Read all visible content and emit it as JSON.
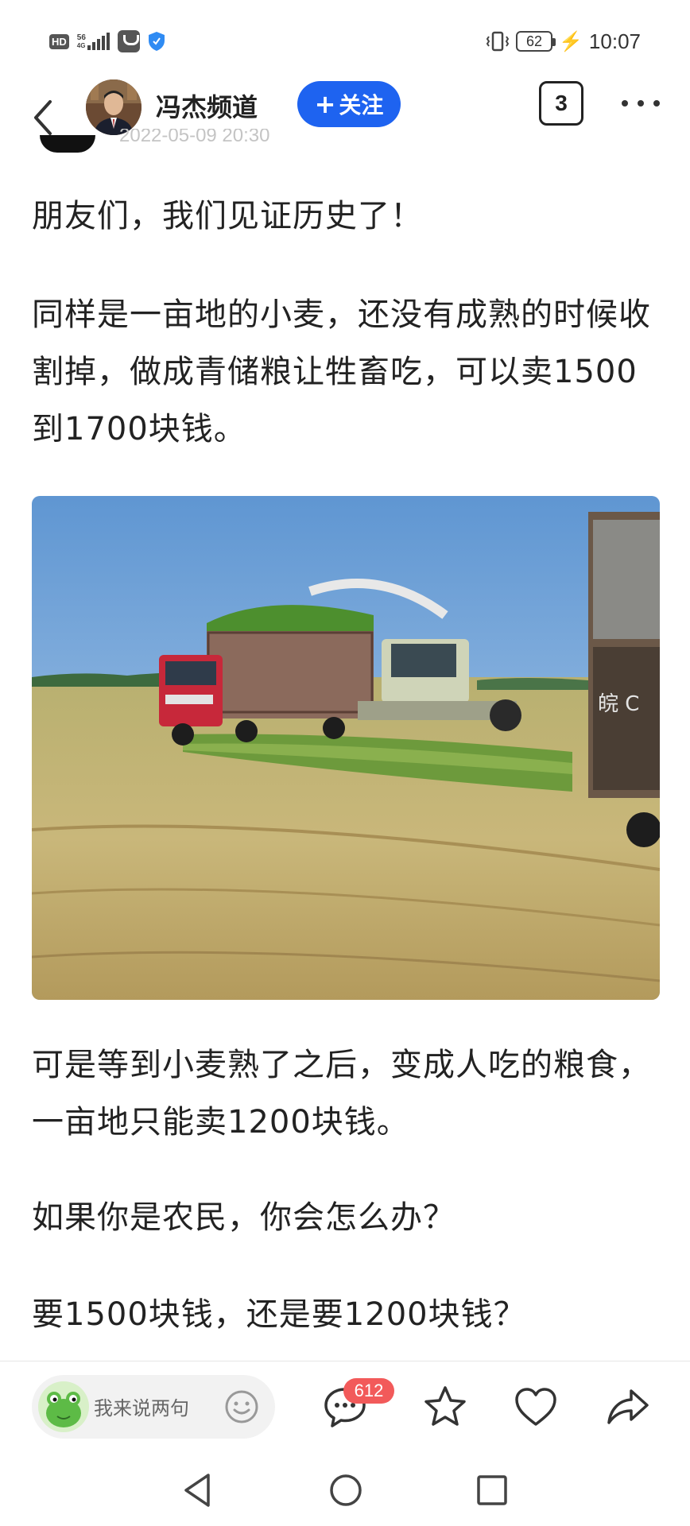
{
  "status_bar": {
    "hd": "HD",
    "network": "56",
    "network_sub": "4G",
    "battery": "62",
    "time": "10:07"
  },
  "header": {
    "channel_name": "冯杰频道",
    "follow_label": "关注",
    "follow_plus": "+",
    "count": "3",
    "partial_timestamp": "2022-05-09 20:30"
  },
  "article": {
    "paragraphs": [
      "朋友们，我们见证历史了！",
      "同样是一亩地的小麦，还没有成熟的时候收割掉，做成青储粮让牲畜吃，可以卖1500到1700块钱。",
      "可是等到小麦熟了之后，变成人吃的粮食，一亩地只能卖1200块钱。",
      "如果你是农民，你会怎么办？",
      "要1500块钱，还是要1200块钱？"
    ]
  },
  "bottom_bar": {
    "comment_placeholder": "我来说两句",
    "comment_count": "612",
    "icons": [
      "emoji-icon",
      "comment-icon",
      "star-icon",
      "heart-icon",
      "share-icon"
    ]
  },
  "nav_bar": {
    "icons": [
      "back-triangle-icon",
      "home-circle-icon",
      "recents-square-icon"
    ]
  },
  "colors": {
    "accent": "#1e63f0",
    "badge": "#f25a5a"
  }
}
